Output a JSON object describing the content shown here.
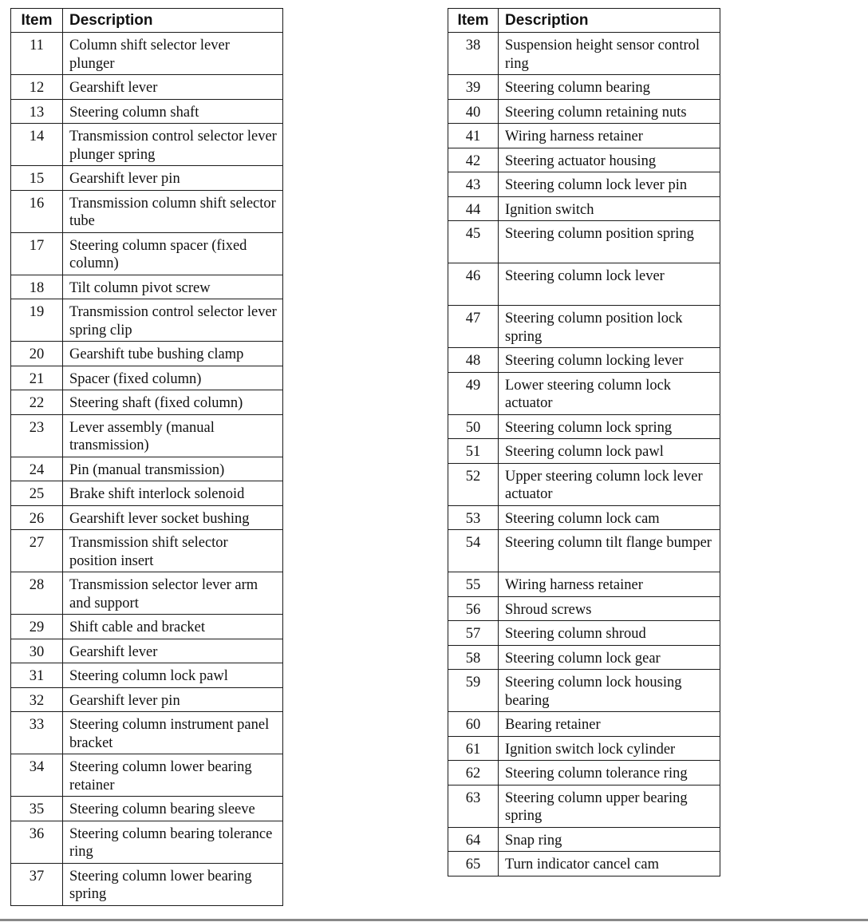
{
  "headers": {
    "item": "Item",
    "description": "Description"
  },
  "left_table": [
    {
      "item": "11",
      "description": "Column shift selector lever plunger",
      "lines": 2
    },
    {
      "item": "12",
      "description": "Gearshift lever",
      "lines": 1
    },
    {
      "item": "13",
      "description": "Steering column shaft",
      "lines": 1
    },
    {
      "item": "14",
      "description": "Transmission control selector lever plunger spring",
      "lines": 2
    },
    {
      "item": "15",
      "description": "Gearshift lever pin",
      "lines": 1
    },
    {
      "item": "16",
      "description": "Transmission column shift selector tube",
      "lines": 2
    },
    {
      "item": "17",
      "description": "Steering column spacer (fixed column)",
      "lines": 2
    },
    {
      "item": "18",
      "description": "Tilt column pivot screw",
      "lines": 1
    },
    {
      "item": "19",
      "description": "Transmission control selector lever spring clip",
      "lines": 2
    },
    {
      "item": "20",
      "description": "Gearshift tube bushing clamp",
      "lines": 1
    },
    {
      "item": "21",
      "description": "Spacer (fixed column)",
      "lines": 1
    },
    {
      "item": "22",
      "description": "Steering shaft (fixed column)",
      "lines": 1
    },
    {
      "item": "23",
      "description": "Lever assembly (manual transmission)",
      "lines": 2
    },
    {
      "item": "24",
      "description": "Pin (manual transmission)",
      "lines": 1
    },
    {
      "item": "25",
      "description": "Brake shift interlock solenoid",
      "lines": 1
    },
    {
      "item": "26",
      "description": "Gearshift lever socket bushing",
      "lines": 1
    },
    {
      "item": "27",
      "description": "Transmission shift selector position insert",
      "lines": 2
    },
    {
      "item": "28",
      "description": "Transmission selector lever arm and support",
      "lines": 2
    },
    {
      "item": "29",
      "description": "Shift cable and bracket",
      "lines": 1
    },
    {
      "item": "30",
      "description": "Gearshift lever",
      "lines": 1
    },
    {
      "item": "31",
      "description": "Steering column lock pawl",
      "lines": 1
    },
    {
      "item": "32",
      "description": "Gearshift lever pin",
      "lines": 1
    },
    {
      "item": "33",
      "description": "Steering column instrument panel bracket",
      "lines": 2
    },
    {
      "item": "34",
      "description": "Steering column lower bearing retainer",
      "lines": 2
    },
    {
      "item": "35",
      "description": "Steering column bearing sleeve",
      "lines": 1
    },
    {
      "item": "36",
      "description": "Steering column bearing tolerance ring",
      "lines": 2
    },
    {
      "item": "37",
      "description": "Steering column lower bearing spring",
      "lines": 2
    }
  ],
  "right_table": [
    {
      "item": "38",
      "description": "Suspension height sensor control ring",
      "lines": 2
    },
    {
      "item": "39",
      "description": "Steering column bearing",
      "lines": 1
    },
    {
      "item": "40",
      "description": "Steering column retaining nuts",
      "lines": 1
    },
    {
      "item": "41",
      "description": "Wiring harness retainer",
      "lines": 1
    },
    {
      "item": "42",
      "description": "Steering actuator housing",
      "lines": 1
    },
    {
      "item": "43",
      "description": "Steering column lock lever pin",
      "lines": 1
    },
    {
      "item": "44",
      "description": "Ignition switch",
      "lines": 1
    },
    {
      "item": "45",
      "description": "Steering column position spring",
      "lines": 2
    },
    {
      "item": "46",
      "description": "Steering column lock lever",
      "lines": 2
    },
    {
      "item": "47",
      "description": "Steering column position lock spring",
      "lines": 2
    },
    {
      "item": "48",
      "description": "Steering column locking lever",
      "lines": 1
    },
    {
      "item": "49",
      "description": "Lower steering column lock actuator",
      "lines": 2
    },
    {
      "item": "50",
      "description": "Steering column lock spring",
      "lines": 1
    },
    {
      "item": "51",
      "description": "Steering column lock pawl",
      "lines": 1
    },
    {
      "item": "52",
      "description": "Upper steering column lock lever actuator",
      "lines": 2
    },
    {
      "item": "53",
      "description": "Steering column lock cam",
      "lines": 1
    },
    {
      "item": "54",
      "description": "Steering column tilt flange bumper",
      "lines": 2
    },
    {
      "item": "55",
      "description": "Wiring harness retainer",
      "lines": 1
    },
    {
      "item": "56",
      "description": "Shroud screws",
      "lines": 1
    },
    {
      "item": "57",
      "description": "Steering column shroud",
      "lines": 1
    },
    {
      "item": "58",
      "description": "Steering column lock gear",
      "lines": 1
    },
    {
      "item": "59",
      "description": "Steering column lock housing bearing",
      "lines": 2
    },
    {
      "item": "60",
      "description": "Bearing retainer",
      "lines": 1
    },
    {
      "item": "61",
      "description": "Ignition switch lock cylinder",
      "lines": 1
    },
    {
      "item": "62",
      "description": "Steering column tolerance ring",
      "lines": 1
    },
    {
      "item": "63",
      "description": "Steering column upper bearing spring",
      "lines": 2
    },
    {
      "item": "64",
      "description": "Snap ring",
      "lines": 1
    },
    {
      "item": "65",
      "description": "Turn indicator cancel cam",
      "lines": 1
    }
  ]
}
